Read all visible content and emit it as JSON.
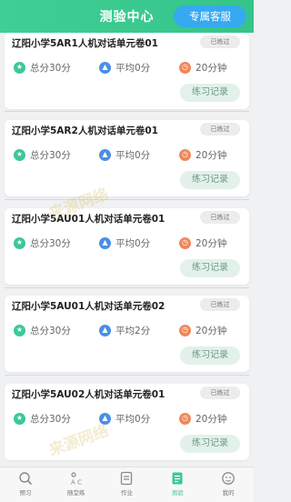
{
  "header": {
    "title": "测验中心",
    "service_button": "专属客服"
  },
  "cards": [
    {
      "title": "辽阳小学5AR1人机对话单元卷01",
      "status": "已练过",
      "total": "总分30分",
      "average": "平均0分",
      "time": "20分钟",
      "record_button": "练习记录"
    },
    {
      "title": "辽阳小学5AR2人机对话单元卷01",
      "status": "已练过",
      "total": "总分30分",
      "average": "平均0分",
      "time": "20分钟",
      "record_button": "练习记录"
    },
    {
      "title": "辽阳小学5AU01人机对话单元卷01",
      "status": "已练过",
      "total": "总分30分",
      "average": "平均0分",
      "time": "20分钟",
      "record_button": "练习记录"
    },
    {
      "title": "辽阳小学5AU01人机对话单元卷02",
      "status": "已练过",
      "total": "总分30分",
      "average": "平均2分",
      "time": "20分钟",
      "record_button": "练习记录"
    },
    {
      "title": "辽阳小学5AU02人机对话单元卷01",
      "status": "已练过",
      "total": "总分30分",
      "average": "平均0分",
      "time": "20分钟",
      "record_button": "练习记录"
    }
  ],
  "watermark": "来源网络",
  "tabbar": {
    "items": [
      {
        "label": "预习",
        "icon": "magnifier-icon"
      },
      {
        "label": "随堂练",
        "icon": "quiz-icon"
      },
      {
        "label": "作业",
        "icon": "homework-icon"
      },
      {
        "label": "测验",
        "icon": "test-icon"
      },
      {
        "label": "我的",
        "icon": "profile-icon"
      }
    ],
    "active_index": 3
  },
  "colors": {
    "header": "#3fcf96",
    "service_button": "#37a9f0",
    "accent_green": "#3cc79a",
    "accent_blue": "#4a8fe6",
    "accent_orange": "#f0875a"
  }
}
